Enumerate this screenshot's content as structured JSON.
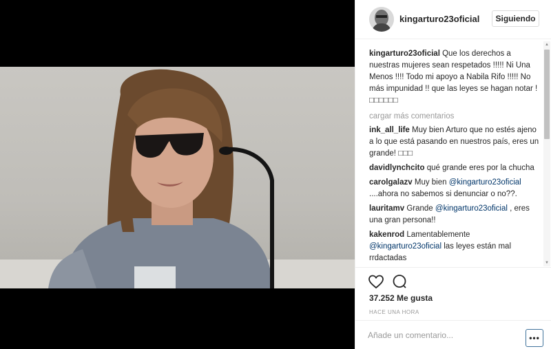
{
  "post": {
    "username": "kingarturo23oficial",
    "follow_label": "Siguiendo",
    "caption_user": "kingarturo23oficial",
    "caption_text": "Que los derechos a nuestras mujeres sean respetados !!!!! Ni Una Menos !!!! Todo mi apoyo a Nabila Rifo !!!!! No más impunidad !! que las leyes se hagan notar !□□□□□□",
    "load_more": "cargar más comentarios",
    "likes": "37.252 Me gusta",
    "time": "HACE UNA HORA",
    "add_comment_placeholder": "Añade un comentario...",
    "more_label": "•••"
  },
  "comments": [
    {
      "user": "ink_all_life",
      "parts": [
        {
          "text": "Muy bien Arturo que no estés ajeno a lo que está pasando en nuestros país, eres un grande! □□□"
        }
      ]
    },
    {
      "user": "davidlynchcito",
      "parts": [
        {
          "text": "qué grande eres por la chucha"
        }
      ]
    },
    {
      "user": "carolgalazv",
      "parts": [
        {
          "text": "Muy bien "
        },
        {
          "mention": "@kingarturo23oficial"
        },
        {
          "text": " ....ahora no sabemos si denunciar o no??."
        }
      ]
    },
    {
      "user": "lauritamv",
      "parts": [
        {
          "text": "Grande "
        },
        {
          "mention": "@kingarturo23oficial"
        },
        {
          "text": " , eres una gran persona!!"
        }
      ]
    },
    {
      "user": "kakenrod",
      "parts": [
        {
          "text": "Lamentablemente "
        },
        {
          "mention": "@kingarturo23oficial"
        },
        {
          "text": " las leyes están mal rrdactadas"
        }
      ]
    }
  ],
  "icons": {
    "like": "heart-icon",
    "comment": "comment-bubble-icon"
  },
  "colors": {
    "mention": "#003569",
    "button_border": "#3f729b",
    "muted": "#999999"
  }
}
